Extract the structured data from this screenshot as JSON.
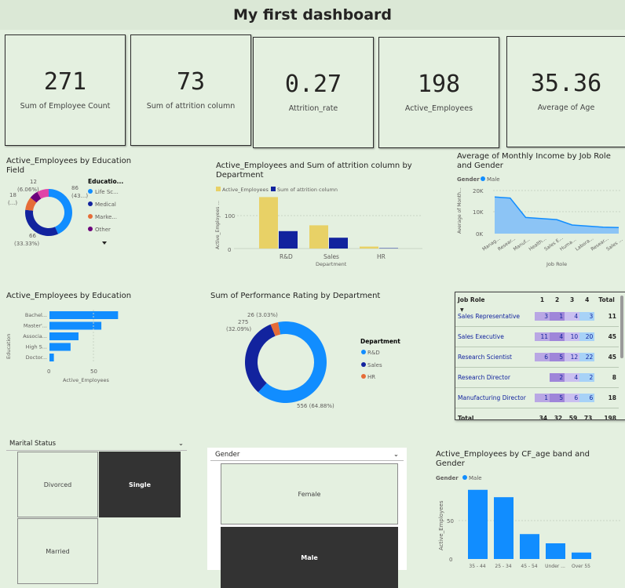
{
  "header": {
    "title": "My first dashboard"
  },
  "kpis": [
    {
      "value": "271",
      "label": "Sum of Employee Count"
    },
    {
      "value": "73",
      "label": "Sum of attrition column"
    },
    {
      "value": "0.27",
      "label": "Attrition_rate"
    },
    {
      "value": "198",
      "label": "Active_Employees"
    },
    {
      "value": "35.36",
      "label": "Average of Age"
    }
  ],
  "edu_field": {
    "title": "Active_Employees by Education Field",
    "legend_title": "Educatio...",
    "legend": [
      "Life Sc...",
      "Medical",
      "Marke...",
      "Other"
    ],
    "labels": {
      "top": "12",
      "top_pct": "(6.06%)",
      "left": "18",
      "left_pct": "(...)",
      "right": "86",
      "right_pct": "(43...)",
      "bottom": "66",
      "bottom_pct": "(33.33%)"
    },
    "colors": [
      "#118dff",
      "#12239e",
      "#e66c37",
      "#6b007b",
      "#e044a7"
    ]
  },
  "dept_chart": {
    "title": "Active_Employees and Sum of attrition column by Department",
    "legend": [
      "Active_Employees",
      "Sum of attrition column"
    ],
    "ylabel": "Active_Employees ...",
    "xlabel": "Department",
    "yticks": [
      "0",
      "100"
    ],
    "colors": [
      "#e8d166",
      "#12239e"
    ]
  },
  "income_chart": {
    "title": "Average of Monthly Income by Job Role and Gender",
    "legend_title": "Gender",
    "legend": [
      "Male"
    ],
    "ylabel": "Average of Month...",
    "xlabel": "Job Role",
    "yticks": [
      "20K",
      "10K",
      "0K"
    ],
    "color": "#118dff"
  },
  "education_chart": {
    "title": "Active_Employees by Education",
    "ylabel": "Education",
    "xlabel": "Active_Employees",
    "xticks": [
      "0",
      "50"
    ]
  },
  "perf_chart": {
    "title": "Sum of Performance Rating by Department",
    "legend_title": "Department",
    "legend": [
      "R&D",
      "Sales",
      "HR"
    ],
    "labels": {
      "hr": "26 (3.03%)",
      "sales": "275",
      "sales_pct": "(32.09%)",
      "rd": "556 (64.88%)"
    },
    "colors": [
      "#118dff",
      "#12239e",
      "#e66c37"
    ]
  },
  "matrix": {
    "headers": [
      "Job Role",
      "1",
      "2",
      "3",
      "4",
      "Total"
    ],
    "rows": [
      {
        "role": "Sales Representative",
        "v": [
          "3",
          "1",
          "4",
          "3"
        ],
        "total": "11"
      },
      {
        "role": "Sales Executive",
        "v": [
          "11",
          "4",
          "10",
          "20"
        ],
        "total": "45"
      },
      {
        "role": "Research Scientist",
        "v": [
          "6",
          "5",
          "12",
          "22"
        ],
        "total": "45"
      },
      {
        "role": "Research Director",
        "v": [
          "",
          "2",
          "4",
          "2"
        ],
        "total": "8"
      },
      {
        "role": "Manufacturing Director",
        "v": [
          "1",
          "5",
          "6",
          "6"
        ],
        "total": "18"
      }
    ],
    "total_row": {
      "role": "Total",
      "v": [
        "34",
        "32",
        "59",
        "73"
      ],
      "total": "198"
    }
  },
  "marital_slicer": {
    "title": "Marital Status",
    "options": [
      "Divorced",
      "Single",
      "Married"
    ]
  },
  "gender_slicer": {
    "title": "Gender",
    "options": [
      "Female",
      "Male"
    ]
  },
  "age_chart": {
    "title": "Active_Employees by CF_age band and Gender",
    "legend_title": "Gender",
    "legend": [
      "Male"
    ],
    "ylabel": "Active_Employees",
    "yticks": [
      "50",
      "0"
    ],
    "color": "#118dff"
  },
  "chart_data": [
    {
      "type": "pie",
      "subtype": "donut",
      "title": "Active_Employees by Education Field",
      "categories": [
        "Life Sc...",
        "Medical",
        "Marke...",
        "Other",
        ""
      ],
      "values": [
        86,
        66,
        18,
        12,
        16
      ]
    },
    {
      "type": "bar",
      "title": "Active_Employees and Sum of attrition column by Department",
      "categories": [
        "R&D",
        "Sales",
        "HR"
      ],
      "series": [
        {
          "name": "Active_Employees",
          "values": [
            133,
            60,
            5
          ]
        },
        {
          "name": "Sum of attrition column",
          "values": [
            45,
            28,
            1
          ]
        }
      ],
      "xlabel": "Department",
      "ylabel": "Active_Employees ...",
      "ylim": [
        0,
        150
      ]
    },
    {
      "type": "area",
      "title": "Average of Monthly Income by Job Role and Gender",
      "categories": [
        "Manag...",
        "Resear...",
        "Manuf...",
        "Health...",
        "Sales E...",
        "Huma...",
        "Labora...",
        "Resear...",
        "Sales ..."
      ],
      "series": [
        {
          "name": "Male",
          "values": [
            17000,
            16500,
            7500,
            7000,
            6500,
            4000,
            3500,
            3000,
            2800
          ]
        }
      ],
      "xlabel": "Job Role",
      "ylabel": "Average of Month...",
      "ylim": [
        0,
        20000
      ]
    },
    {
      "type": "bar",
      "orientation": "horizontal",
      "title": "Active_Employees by Education",
      "categories": [
        "Bachel...",
        "Master'...",
        "Associa...",
        "High S...",
        "Doctor..."
      ],
      "values": [
        78,
        59,
        33,
        24,
        5
      ],
      "xlabel": "Active_Employees",
      "ylabel": "Education",
      "xlim": [
        0,
        90
      ]
    },
    {
      "type": "pie",
      "subtype": "donut",
      "title": "Sum of Performance Rating by Department",
      "categories": [
        "R&D",
        "Sales",
        "HR"
      ],
      "values": [
        556,
        275,
        26
      ]
    },
    {
      "type": "bar",
      "title": "Active_Employees by CF_age band and Gender",
      "categories": [
        "35 - 44",
        "25 - 34",
        "45 - 54",
        "Under ...",
        "Over 55"
      ],
      "series": [
        {
          "name": "Male",
          "values": [
            75,
            67,
            27,
            17,
            7
          ]
        }
      ],
      "ylabel": "Active_Employees",
      "ylim": [
        0,
        85
      ]
    }
  ]
}
